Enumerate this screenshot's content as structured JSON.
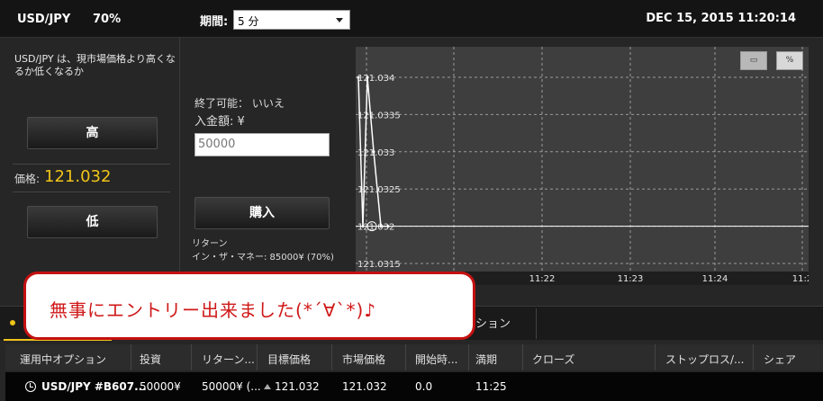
{
  "header": {
    "symbol": "USD/JPY",
    "payout": "70%",
    "period_label": "期間:",
    "period_value": "5 分",
    "datetime": "DEC 15, 2015 11:20:14"
  },
  "left_panel": {
    "description": "USD/JPY は、現市場価格より高くなるか低くなるか",
    "high_button": "高",
    "price_label": "価格:",
    "price_value": "121.032",
    "low_button": "低"
  },
  "middle_panel": {
    "exit_label": "終了可能： いいえ",
    "amount_label": "入金額: ¥",
    "amount_value": "50000",
    "buy_button": "購入",
    "return_label": "リターン",
    "return_value": "イン・ザ・マネー: 85000¥ (70%)"
  },
  "chart_controls": {
    "button_1": "▭",
    "button_2": "%"
  },
  "chart_data": {
    "type": "line",
    "x_tick_labels": [
      "11:22",
      "11:23",
      "11:24",
      "11:2"
    ],
    "y_tick_labels": [
      "121.034",
      "121.0335",
      "121.033",
      "121.0325",
      "121.032",
      "121.0315"
    ],
    "ylim": [
      121.0315,
      121.034
    ],
    "series": [
      {
        "values": [
          121.034,
          121.032,
          121.034,
          121.033,
          121.032,
          121.032
        ]
      }
    ],
    "target_price": 121.032,
    "colors": {
      "line": "#ffffff",
      "grid": "#9a9a9a",
      "background": "#3e3e3e"
    }
  },
  "options": {
    "tab_2_label": "ション",
    "columns": [
      "運用中オプション",
      "投資",
      "リターン...",
      "目標価格",
      "市場価格",
      "開始時...",
      "満期",
      "クローズ",
      "ストップロス/...",
      "シェア"
    ],
    "rows": [
      [
        "USD/JPY #B607...",
        "50000¥",
        "50000¥ (...",
        "121.032",
        "121.032",
        "0.0",
        "11:25",
        "",
        "",
        ""
      ]
    ]
  },
  "toast": {
    "message": "無事にエントリー出来ました(*´∀`*)♪"
  },
  "colors": {
    "accent": "#f0c419",
    "toast_border": "#c41010",
    "toast_text": "#d01818"
  }
}
